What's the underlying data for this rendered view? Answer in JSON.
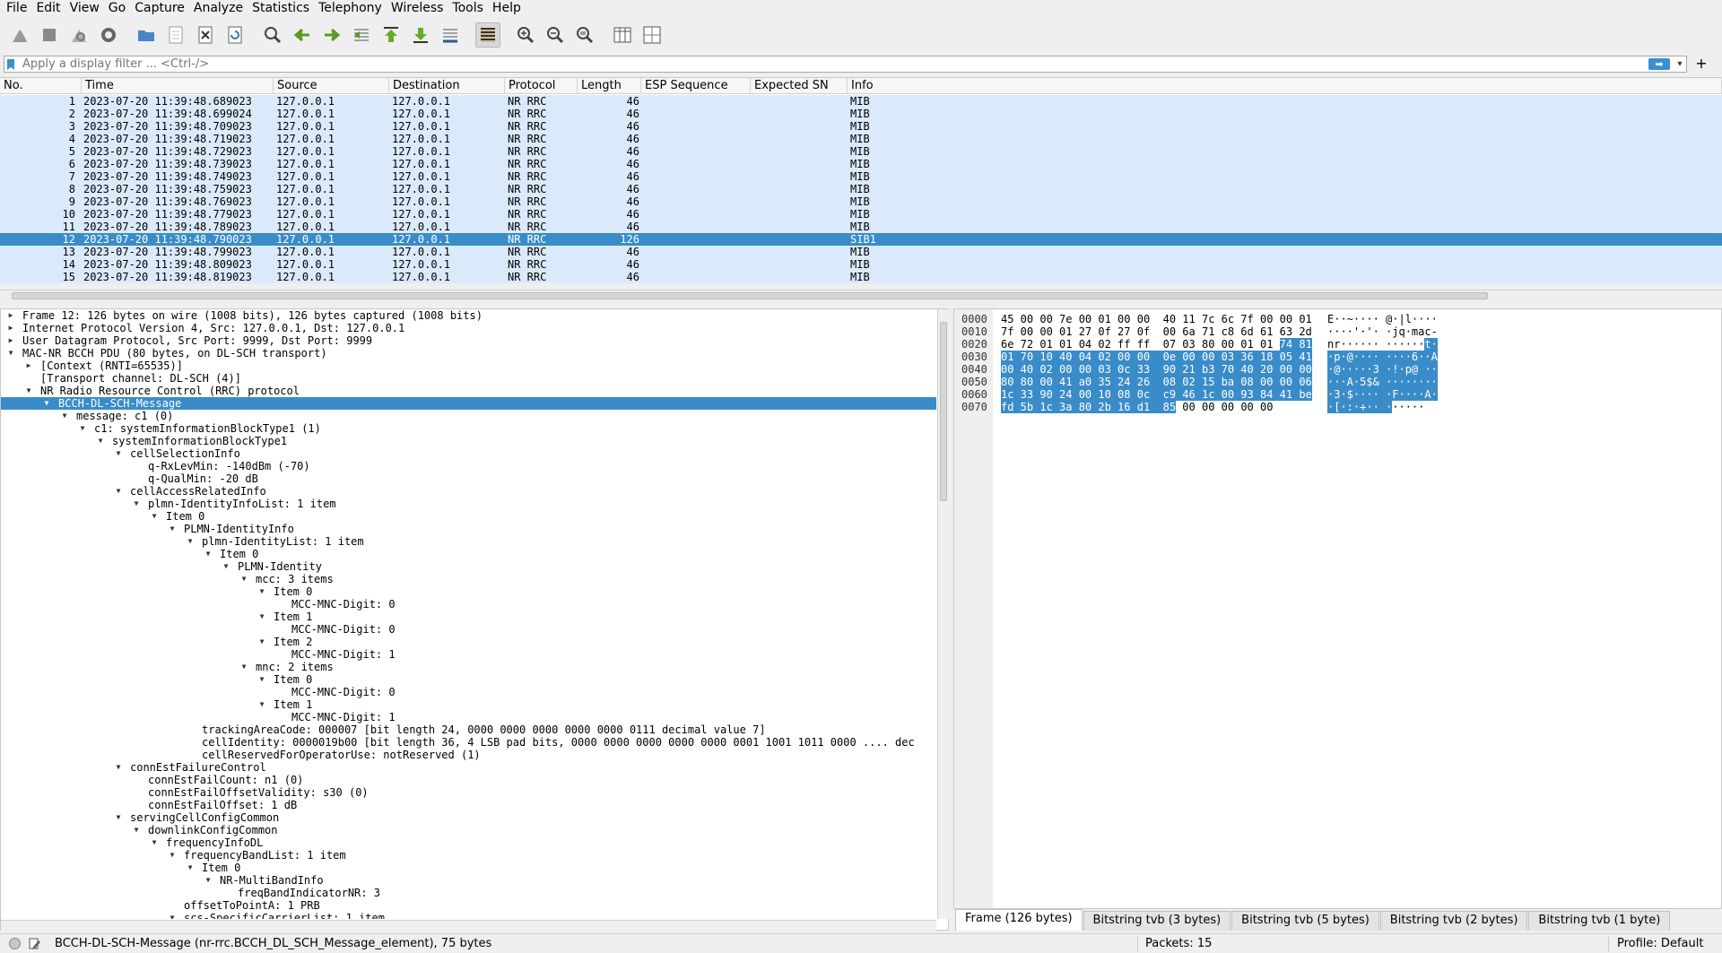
{
  "menu": [
    "File",
    "Edit",
    "View",
    "Go",
    "Capture",
    "Analyze",
    "Statistics",
    "Telephony",
    "Wireless",
    "Tools",
    "Help"
  ],
  "toolbar": {
    "icons": [
      "shark-fin-start-icon",
      "stop-icon",
      "restart-icon",
      "capture-options-icon",
      "open-file-icon",
      "save-file-icon",
      "close-file-icon",
      "reload-icon",
      "find-packet-icon",
      "go-back-icon",
      "go-forward-icon",
      "go-to-packet-icon",
      "go-first-icon",
      "go-last-icon",
      "auto-scroll-icon",
      "colorize-icon",
      "zoom-in-icon",
      "zoom-out-icon",
      "zoom-normal-icon",
      "resize-columns-icon",
      "expand-subtrees-icon"
    ]
  },
  "filter": {
    "placeholder": "Apply a display filter ... <Ctrl-/>",
    "apply_label": "➡",
    "plus_label": "+"
  },
  "packet_list": {
    "columns": [
      "No.",
      "Time",
      "Source",
      "Destination",
      "Protocol",
      "Length",
      "ESP Sequence",
      "Expected SN",
      "Info"
    ],
    "rows": [
      {
        "no": "1",
        "time": "2023-07-20 11:39:48.689023",
        "src": "127.0.0.1",
        "dst": "127.0.0.1",
        "proto": "NR RRC",
        "len": "46",
        "info": "MIB"
      },
      {
        "no": "2",
        "time": "2023-07-20 11:39:48.699024",
        "src": "127.0.0.1",
        "dst": "127.0.0.1",
        "proto": "NR RRC",
        "len": "46",
        "info": "MIB"
      },
      {
        "no": "3",
        "time": "2023-07-20 11:39:48.709023",
        "src": "127.0.0.1",
        "dst": "127.0.0.1",
        "proto": "NR RRC",
        "len": "46",
        "info": "MIB"
      },
      {
        "no": "4",
        "time": "2023-07-20 11:39:48.719023",
        "src": "127.0.0.1",
        "dst": "127.0.0.1",
        "proto": "NR RRC",
        "len": "46",
        "info": "MIB"
      },
      {
        "no": "5",
        "time": "2023-07-20 11:39:48.729023",
        "src": "127.0.0.1",
        "dst": "127.0.0.1",
        "proto": "NR RRC",
        "len": "46",
        "info": "MIB"
      },
      {
        "no": "6",
        "time": "2023-07-20 11:39:48.739023",
        "src": "127.0.0.1",
        "dst": "127.0.0.1",
        "proto": "NR RRC",
        "len": "46",
        "info": "MIB"
      },
      {
        "no": "7",
        "time": "2023-07-20 11:39:48.749023",
        "src": "127.0.0.1",
        "dst": "127.0.0.1",
        "proto": "NR RRC",
        "len": "46",
        "info": "MIB"
      },
      {
        "no": "8",
        "time": "2023-07-20 11:39:48.759023",
        "src": "127.0.0.1",
        "dst": "127.0.0.1",
        "proto": "NR RRC",
        "len": "46",
        "info": "MIB"
      },
      {
        "no": "9",
        "time": "2023-07-20 11:39:48.769023",
        "src": "127.0.0.1",
        "dst": "127.0.0.1",
        "proto": "NR RRC",
        "len": "46",
        "info": "MIB"
      },
      {
        "no": "10",
        "time": "2023-07-20 11:39:48.779023",
        "src": "127.0.0.1",
        "dst": "127.0.0.1",
        "proto": "NR RRC",
        "len": "46",
        "info": "MIB"
      },
      {
        "no": "11",
        "time": "2023-07-20 11:39:48.789023",
        "src": "127.0.0.1",
        "dst": "127.0.0.1",
        "proto": "NR RRC",
        "len": "46",
        "info": "MIB"
      },
      {
        "no": "12",
        "time": "2023-07-20 11:39:48.790023",
        "src": "127.0.0.1",
        "dst": "127.0.0.1",
        "proto": "NR RRC",
        "len": "126",
        "info": "SIB1",
        "selected": true
      },
      {
        "no": "13",
        "time": "2023-07-20 11:39:48.799023",
        "src": "127.0.0.1",
        "dst": "127.0.0.1",
        "proto": "NR RRC",
        "len": "46",
        "info": "MIB"
      },
      {
        "no": "14",
        "time": "2023-07-20 11:39:48.809023",
        "src": "127.0.0.1",
        "dst": "127.0.0.1",
        "proto": "NR RRC",
        "len": "46",
        "info": "MIB"
      },
      {
        "no": "15",
        "time": "2023-07-20 11:39:48.819023",
        "src": "127.0.0.1",
        "dst": "127.0.0.1",
        "proto": "NR RRC",
        "len": "46",
        "info": "MIB"
      }
    ]
  },
  "detail_tree": [
    {
      "depth": 0,
      "state": "collapsed",
      "text": "Frame 12: 126 bytes on wire (1008 bits), 126 bytes captured (1008 bits)"
    },
    {
      "depth": 0,
      "state": "collapsed",
      "text": "Internet Protocol Version 4, Src: 127.0.0.1, Dst: 127.0.0.1"
    },
    {
      "depth": 0,
      "state": "collapsed",
      "text": "User Datagram Protocol, Src Port: 9999, Dst Port: 9999"
    },
    {
      "depth": 0,
      "state": "expanded",
      "text": "MAC-NR BCCH PDU (80 bytes, on DL-SCH transport)"
    },
    {
      "depth": 1,
      "state": "collapsed",
      "text": "[Context (RNTI=65535)]"
    },
    {
      "depth": 1,
      "state": "leaf",
      "text": "[Transport channel: DL-SCH (4)]"
    },
    {
      "depth": 1,
      "state": "expanded",
      "text": "NR Radio Resource Control (RRC) protocol"
    },
    {
      "depth": 2,
      "state": "expanded",
      "text": "BCCH-DL-SCH-Message",
      "selected": true
    },
    {
      "depth": 3,
      "state": "expanded",
      "text": "message: c1 (0)"
    },
    {
      "depth": 4,
      "state": "expanded",
      "text": "c1: systemInformationBlockType1 (1)"
    },
    {
      "depth": 5,
      "state": "expanded",
      "text": "systemInformationBlockType1"
    },
    {
      "depth": 6,
      "state": "expanded",
      "text": "cellSelectionInfo"
    },
    {
      "depth": 7,
      "state": "leaf",
      "text": "q-RxLevMin: -140dBm (-70)"
    },
    {
      "depth": 7,
      "state": "leaf",
      "text": "q-QualMin: -20 dB"
    },
    {
      "depth": 6,
      "state": "expanded",
      "text": "cellAccessRelatedInfo"
    },
    {
      "depth": 7,
      "state": "expanded",
      "text": "plmn-IdentityInfoList: 1 item"
    },
    {
      "depth": 8,
      "state": "expanded",
      "text": "Item 0"
    },
    {
      "depth": 9,
      "state": "expanded",
      "text": "PLMN-IdentityInfo"
    },
    {
      "depth": 10,
      "state": "expanded",
      "text": "plmn-IdentityList: 1 item"
    },
    {
      "depth": 11,
      "state": "expanded",
      "text": "Item 0"
    },
    {
      "depth": 12,
      "state": "expanded",
      "text": "PLMN-Identity"
    },
    {
      "depth": 13,
      "state": "expanded",
      "text": "mcc: 3 items"
    },
    {
      "depth": 14,
      "state": "expanded",
      "text": "Item 0"
    },
    {
      "depth": 15,
      "state": "leaf",
      "text": "MCC-MNC-Digit: 0"
    },
    {
      "depth": 14,
      "state": "expanded",
      "text": "Item 1"
    },
    {
      "depth": 15,
      "state": "leaf",
      "text": "MCC-MNC-Digit: 0"
    },
    {
      "depth": 14,
      "state": "expanded",
      "text": "Item 2"
    },
    {
      "depth": 15,
      "state": "leaf",
      "text": "MCC-MNC-Digit: 1"
    },
    {
      "depth": 13,
      "state": "expanded",
      "text": "mnc: 2 items"
    },
    {
      "depth": 14,
      "state": "expanded",
      "text": "Item 0"
    },
    {
      "depth": 15,
      "state": "leaf",
      "text": "MCC-MNC-Digit: 0"
    },
    {
      "depth": 14,
      "state": "expanded",
      "text": "Item 1"
    },
    {
      "depth": 15,
      "state": "leaf",
      "text": "MCC-MNC-Digit: 1"
    },
    {
      "depth": 10,
      "state": "leaf",
      "text": "trackingAreaCode: 000007 [bit length 24, 0000 0000  0000 0000  0000 0111 decimal value 7]"
    },
    {
      "depth": 10,
      "state": "leaf",
      "text": "cellIdentity: 0000019b00 [bit length 36, 4 LSB pad bits, 0000 0000  0000 0000  0000 0001  1001 1011  0000 .... dec"
    },
    {
      "depth": 10,
      "state": "leaf",
      "text": "cellReservedForOperatorUse: notReserved (1)"
    },
    {
      "depth": 6,
      "state": "expanded",
      "text": "connEstFailureControl"
    },
    {
      "depth": 7,
      "state": "leaf",
      "text": "connEstFailCount: n1 (0)"
    },
    {
      "depth": 7,
      "state": "leaf",
      "text": "connEstFailOffsetValidity: s30 (0)"
    },
    {
      "depth": 7,
      "state": "leaf",
      "text": "connEstFailOffset: 1 dB"
    },
    {
      "depth": 6,
      "state": "expanded",
      "text": "servingCellConfigCommon"
    },
    {
      "depth": 7,
      "state": "expanded",
      "text": "downlinkConfigCommon"
    },
    {
      "depth": 8,
      "state": "expanded",
      "text": "frequencyInfoDL"
    },
    {
      "depth": 9,
      "state": "expanded",
      "text": "frequencyBandList: 1 item"
    },
    {
      "depth": 10,
      "state": "expanded",
      "text": "Item 0"
    },
    {
      "depth": 11,
      "state": "expanded",
      "text": "NR-MultiBandInfo"
    },
    {
      "depth": 12,
      "state": "leaf",
      "text": "freqBandIndicatorNR: 3"
    },
    {
      "depth": 9,
      "state": "leaf",
      "text": "offsetToPointA: 1 PRB"
    },
    {
      "depth": 9,
      "state": "expanded",
      "text": "scs-SpecificCarrierList: 1 item"
    }
  ],
  "bytes": [
    {
      "off": "0000",
      "hex": [
        [
          "45 00 00 7e 00 01 00 00  40 11 7c 6c 7f 00 00 01",
          false
        ]
      ],
      "ascii": [
        [
          "E··~···· @·|l····",
          false
        ]
      ]
    },
    {
      "off": "0010",
      "hex": [
        [
          "7f 00 00 01 27 0f 27 0f  00 6a 71 c8 6d 61 63 2d",
          false
        ]
      ],
      "ascii": [
        [
          "····'·'· ·jq·mac-",
          false
        ]
      ]
    },
    {
      "off": "0020",
      "hex": [
        [
          "6e 72 01 01 04 02 ff ff  07 03 80 00 01 01 ",
          false
        ],
        [
          "74 81",
          true
        ]
      ],
      "ascii": [
        [
          "nr······ ······",
          false
        ],
        [
          "t·",
          true
        ]
      ]
    },
    {
      "off": "0030",
      "hex": [
        [
          "01 70 10 40 04 02 00 00  0e 00 00 03 36 18 05 41",
          true
        ]
      ],
      "ascii": [
        [
          "·p·@···· ····6··A",
          true
        ]
      ]
    },
    {
      "off": "0040",
      "hex": [
        [
          "00 40 02 00 00 03 0c 33  90 21 b3 70 40 20 00 00",
          true
        ]
      ],
      "ascii": [
        [
          "·@·····3 ·!·p@ ··",
          true
        ]
      ]
    },
    {
      "off": "0050",
      "hex": [
        [
          "80 80 00 41 a0 35 24 26  08 02 15 ba 08 00 00 06",
          true
        ]
      ],
      "ascii": [
        [
          "···A·5$& ········",
          true
        ]
      ]
    },
    {
      "off": "0060",
      "hex": [
        [
          "1c 33 90 24 00 10 08 0c  c9 46 1c 00 93 84 41 be",
          true
        ]
      ],
      "ascii": [
        [
          "·3·$···· ·F····A·",
          true
        ]
      ]
    },
    {
      "off": "0070",
      "hex": [
        [
          "fd 5b 1c 3a 80 2b 16 d1  85",
          true
        ],
        [
          " 00 00 00 00 00",
          false
        ]
      ],
      "ascii": [
        [
          "·[·:·+·· ·",
          true
        ],
        [
          "·····",
          false
        ]
      ]
    }
  ],
  "bytes_tabs": [
    "Frame (126 bytes)",
    "Bitstring tvb (3 bytes)",
    "Bitstring tvb (5 bytes)",
    "Bitstring tvb (2 bytes)",
    "Bitstring tvb (1 byte)"
  ],
  "status": {
    "field_text": "BCCH-DL-SCH-Message (nr-rrc.BCCH_DL_SCH_Message_element), 75 bytes",
    "packets": "Packets: 15",
    "profile": "Profile: Default"
  },
  "colors": {
    "selection": "#3a8cc9",
    "row_bg": "#dbeafb",
    "chrome": "#efefef"
  }
}
